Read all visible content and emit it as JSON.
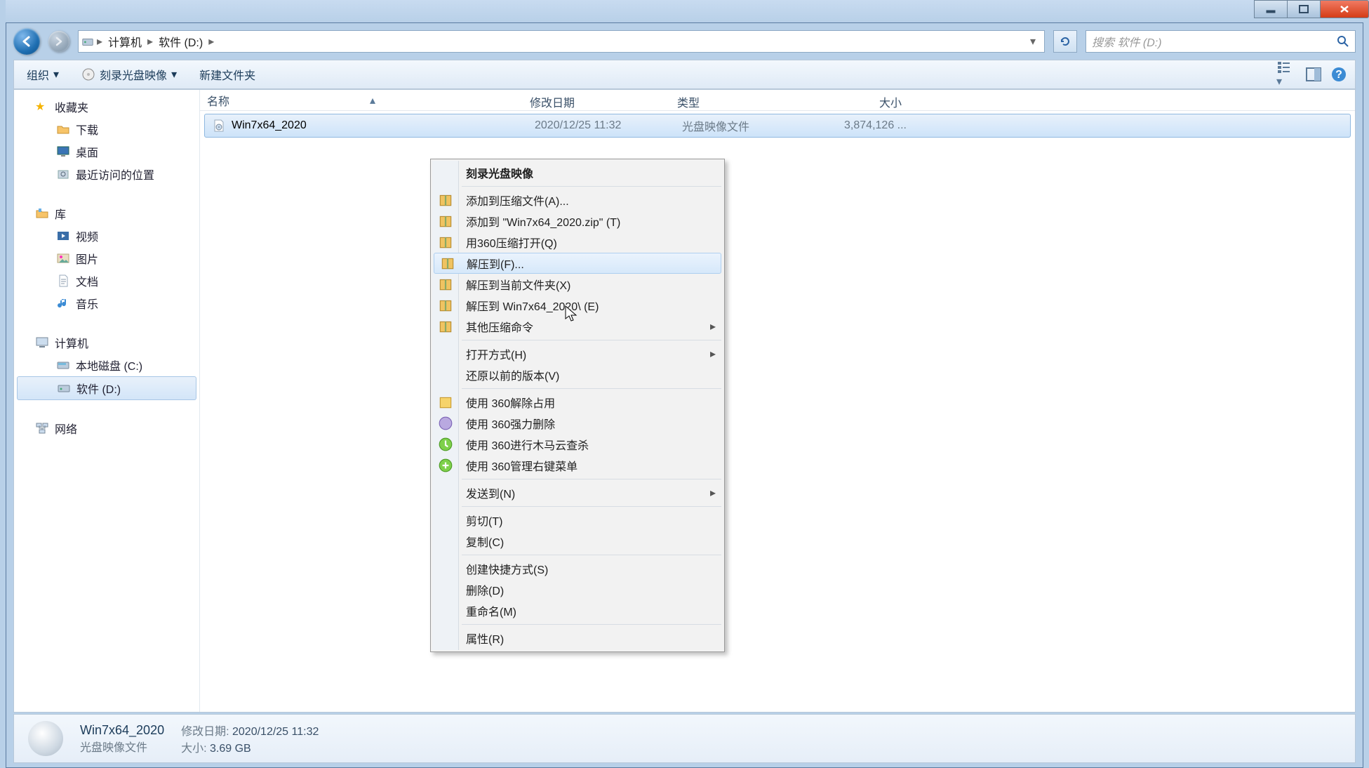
{
  "window": {
    "breadcrumb": {
      "computer": "计算机",
      "drive": "软件 (D:)"
    },
    "search_placeholder": "搜索 软件 (D:)"
  },
  "toolbar": {
    "organize": "组织",
    "burn": "刻录光盘映像",
    "newfolder": "新建文件夹"
  },
  "sidebar": {
    "favorites": "收藏夹",
    "downloads": "下载",
    "desktop": "桌面",
    "recent": "最近访问的位置",
    "libraries": "库",
    "video": "视频",
    "pictures": "图片",
    "documents": "文档",
    "music": "音乐",
    "computer": "计算机",
    "localC": "本地磁盘 (C:)",
    "softD": "软件 (D:)",
    "network": "网络"
  },
  "cols": {
    "name": "名称",
    "date": "修改日期",
    "type": "类型",
    "size": "大小"
  },
  "file": {
    "name": "Win7x64_2020",
    "date": "2020/12/25 11:32",
    "type": "光盘映像文件",
    "size": "3,874,126 ..."
  },
  "ctx": {
    "burn": "刻录光盘映像",
    "addA": "添加到压缩文件(A)...",
    "addZip": "添加到 \"Win7x64_2020.zip\" (T)",
    "openQ": "用360压缩打开(Q)",
    "extractF": "解压到(F)...",
    "extractX": "解压到当前文件夹(X)",
    "extractE": "解压到 Win7x64_2020\\ (E)",
    "other": "其他压缩命令",
    "openWith": "打开方式(H)",
    "restoreV": "还原以前的版本(V)",
    "unlock": "使用 360解除占用",
    "forceDel": "使用 360强力删除",
    "trojan": "使用 360进行木马云查杀",
    "manage": "使用 360管理右键菜单",
    "sendTo": "发送到(N)",
    "cut": "剪切(T)",
    "copy": "复制(C)",
    "shortcut": "创建快捷方式(S)",
    "delete": "删除(D)",
    "rename": "重命名(M)",
    "props": "属性(R)"
  },
  "details": {
    "name": "Win7x64_2020",
    "type": "光盘映像文件",
    "mod_label": "修改日期:",
    "mod_val": "2020/12/25 11:32",
    "size_label": "大小:",
    "size_val": "3.69 GB"
  }
}
